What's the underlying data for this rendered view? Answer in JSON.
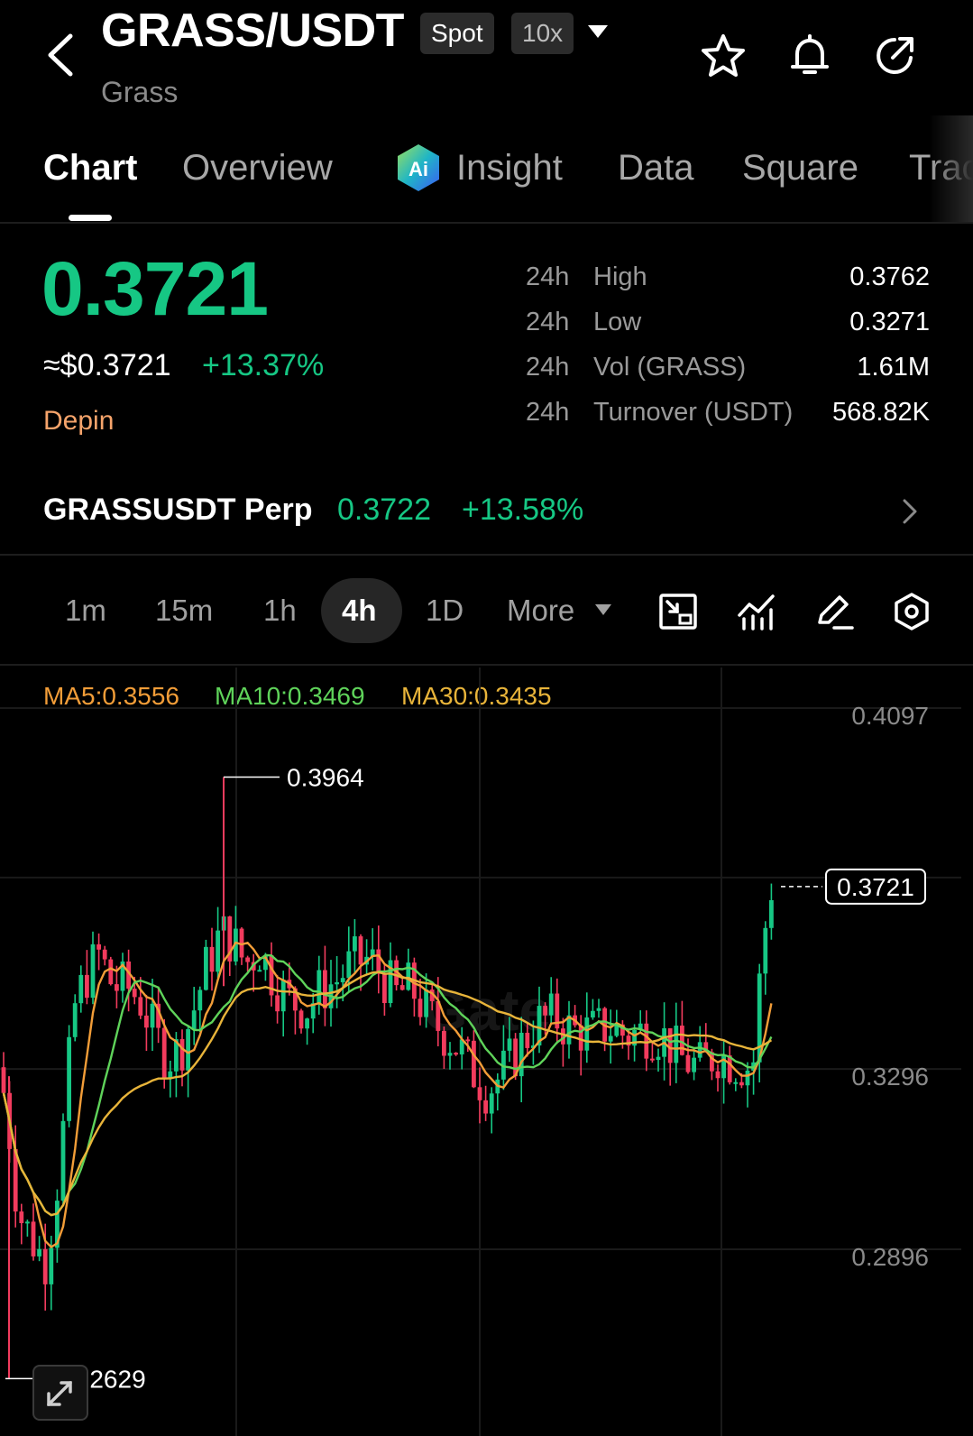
{
  "header": {
    "pair": "GRASS/USDT",
    "market_badge": "Spot",
    "leverage_badge": "10x",
    "name": "Grass",
    "icons": [
      "back-arrow-icon",
      "caret-down-icon",
      "star-icon",
      "bell-icon",
      "share-icon"
    ]
  },
  "tabs": [
    {
      "label": "Chart"
    },
    {
      "label": "Overview"
    },
    {
      "label": "Insight"
    },
    {
      "label": "Data"
    },
    {
      "label": "Square"
    },
    {
      "label": "Trac"
    }
  ],
  "price": {
    "last": "0.3721",
    "fiat": "≈$0.3721",
    "change": "+13.37%",
    "tag": "Depin",
    "up_color": "#16c784",
    "down_color": "#f23b5d"
  },
  "stats": [
    {
      "period": "24h",
      "name": "High",
      "value": "0.3762"
    },
    {
      "period": "24h",
      "name": "Low",
      "value": "0.3271"
    },
    {
      "period": "24h",
      "name": "Vol (GRASS)",
      "value": "1.61M"
    },
    {
      "period": "24h",
      "name": "Turnover (USDT)",
      "value": "568.82K"
    }
  ],
  "perp": {
    "name": "GRASSUSDT Perp",
    "price": "0.3722",
    "change": "+13.58%"
  },
  "intervals": [
    {
      "label": "1m"
    },
    {
      "label": "15m"
    },
    {
      "label": "1h"
    },
    {
      "label": "4h"
    },
    {
      "label": "1D"
    },
    {
      "label": "More"
    }
  ],
  "active_interval": "4h",
  "toolbar_icons": [
    "fullscreen-icon",
    "indicators-icon",
    "draw-icon",
    "settings-icon"
  ],
  "ma": [
    {
      "label": "MA5:0.3556",
      "color": "#f29d38"
    },
    {
      "label": "MA10:0.3469",
      "color": "#5fd35a"
    },
    {
      "label": "MA30:0.3435",
      "color": "#e8b43a"
    }
  ],
  "chart_data": {
    "type": "candlestick",
    "y_axis_labels": [
      "0.4097",
      "0.3296",
      "0.2896"
    ],
    "last_price_label": "0.3721",
    "high_marker": "0.3964",
    "low_marker": "0.2629",
    "ylim": [
      0.2629,
      0.4097
    ],
    "grid": true,
    "watermark": "Gate"
  }
}
